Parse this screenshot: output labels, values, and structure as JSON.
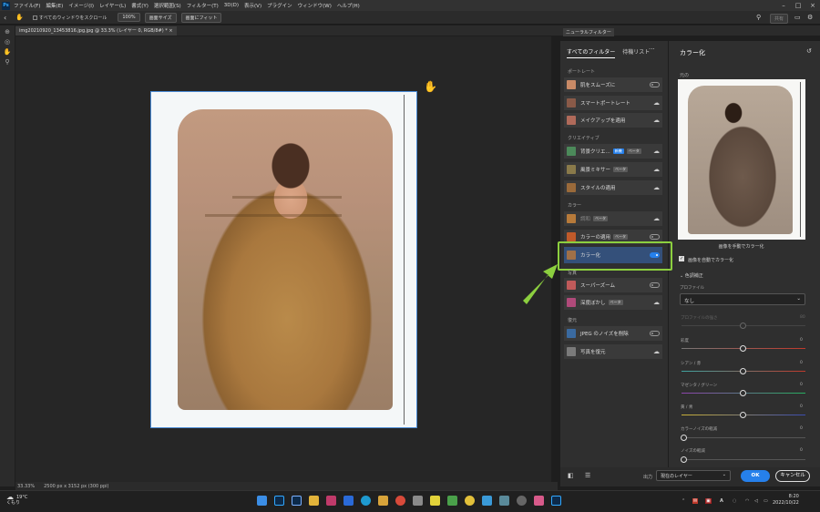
{
  "menubar": {
    "items": [
      "ファイル(F)",
      "編集(E)",
      "イメージ(I)",
      "レイヤー(L)",
      "書式(Y)",
      "選択範囲(S)",
      "フィルター(T)",
      "3D(D)",
      "表示(V)",
      "プラグイン",
      "ウィンドウ(W)",
      "ヘルプ(H)"
    ]
  },
  "options": {
    "scroll_all": "すべてのウィンドウをスクロール",
    "zoom": "100%",
    "fit_screen": "画面サイズ",
    "fill_screen": "画面にフィット",
    "share": "共有"
  },
  "document": {
    "tab": "img20210920_13453816.jpg.jpg @ 33.3% (レイヤー 0, RGB/8#) *",
    "close": "×",
    "status_zoom": "33.33%",
    "status_size": "2500 px x 3152 px (300 ppi)"
  },
  "panel": {
    "title": "ニューラルフィルター",
    "tab_all": "すべてのフィルター",
    "tab_wait": "待機リスト",
    "menu": "···"
  },
  "sections": {
    "portrait": "ポートレート",
    "creative": "クリエイティブ",
    "color": "カラー",
    "photo": "写真",
    "restore": "復元"
  },
  "filters": [
    {
      "label": "肌をスムーズに",
      "ctrl": "toggle"
    },
    {
      "label": "スマートポートレート",
      "ctrl": "cloud"
    },
    {
      "label": "メイクアップを適用",
      "ctrl": "cloud"
    },
    {
      "label": "背景クリエ...",
      "badge1": "新機",
      "badge2": "ベータ",
      "ctrl": "cloud"
    },
    {
      "label": "風景ミキサー",
      "badge1": "ベータ",
      "ctrl": "cloud"
    },
    {
      "label": "スタイルの適用",
      "ctrl": "cloud"
    },
    {
      "label": "調和",
      "badge1": "ベータ",
      "ctrl": "cloud"
    },
    {
      "label": "カラーの適用",
      "badge1": "ベータ",
      "ctrl": "toggle"
    },
    {
      "label": "カラー化",
      "ctrl": "toggle-on"
    },
    {
      "label": "スーパーズーム",
      "ctrl": "toggle"
    },
    {
      "label": "深度ぼかし",
      "badge1": "ベータ",
      "ctrl": "cloud"
    },
    {
      "label": "JPEG のノイズを削除",
      "ctrl": "toggle"
    },
    {
      "label": "写真を復元",
      "ctrl": "cloud"
    }
  ],
  "right": {
    "title": "カラー化",
    "original_label": "元の",
    "caption": "画像を手動でカラー化",
    "auto_label": "画像を自動でカラー化",
    "section": "色調補正",
    "profile_label": "プロファイル",
    "profile_value": "なし",
    "profile_strength": "プロファイルの強さ",
    "profile_strength_val": "80",
    "sliders": [
      {
        "label": "彩度",
        "value": "0",
        "color": "#c0392b"
      },
      {
        "label": "シアン / 赤",
        "value": "0",
        "color": "#3fa3a0"
      },
      {
        "label": "マゼンタ / グリーン",
        "value": "0",
        "color": "#8e44ad"
      },
      {
        "label": "黄 / 青",
        "value": "0",
        "color": "#3b4cb0"
      },
      {
        "label": "カラーノイズの軽減",
        "value": "0",
        "color": "#555555"
      },
      {
        "label": "ノイズの軽減",
        "value": "0",
        "color": "#555555"
      }
    ]
  },
  "bottom": {
    "output_label": "出力",
    "output_value": "現在のレイヤー",
    "ok": "OK",
    "cancel": "キャンセル"
  },
  "taskbar": {
    "temp": "19°C",
    "weather": "くもり",
    "time": "8:20",
    "date": "2022/10/22",
    "tray_a": "A"
  },
  "colors": {
    "accent": "#2680eb",
    "highlight": "#8ccf3f"
  }
}
